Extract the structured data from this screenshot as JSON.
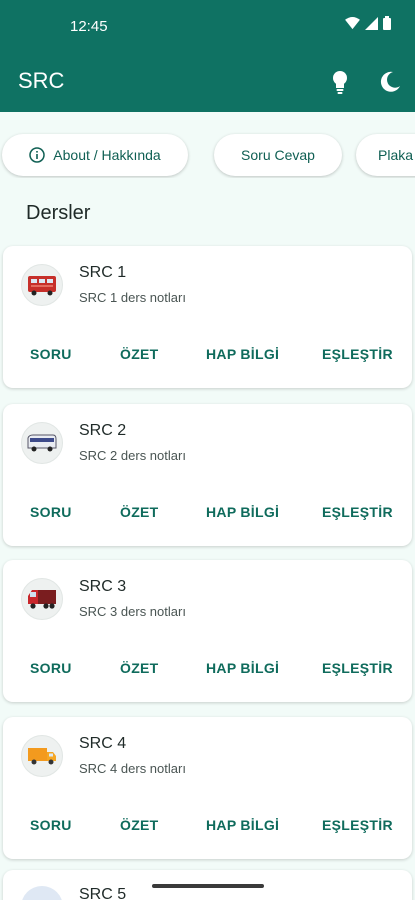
{
  "status": {
    "time": "12:45"
  },
  "appbar": {
    "title": "SRC",
    "icons": [
      "lightbulb-icon",
      "moon-icon"
    ]
  },
  "chips": [
    {
      "label": "About / Hakkında",
      "icon": "info-icon"
    },
    {
      "label": "Soru Cevap"
    },
    {
      "label": "Plaka"
    }
  ],
  "section": {
    "title": "Dersler"
  },
  "actions": {
    "soru": "SORU",
    "ozet": "ÖZET",
    "hap": "HAP BİLGİ",
    "eslestir": "EŞLEŞTİR"
  },
  "courses": [
    {
      "title": "SRC 1",
      "subtitle": "SRC 1 ders notları",
      "icon": "bus-icon"
    },
    {
      "title": "SRC 2",
      "subtitle": "SRC 2 ders notları",
      "icon": "minibus-icon"
    },
    {
      "title": "SRC 3",
      "subtitle": "SRC 3 ders notları",
      "icon": "truck-icon"
    },
    {
      "title": "SRC 4",
      "subtitle": "SRC 4 ders notları",
      "icon": "delivery-truck-icon"
    },
    {
      "title": "SRC 5"
    }
  ],
  "colors": {
    "primary": "#0f7263",
    "accent_text": "#0f6b5c",
    "background": "#f2fbf8"
  }
}
